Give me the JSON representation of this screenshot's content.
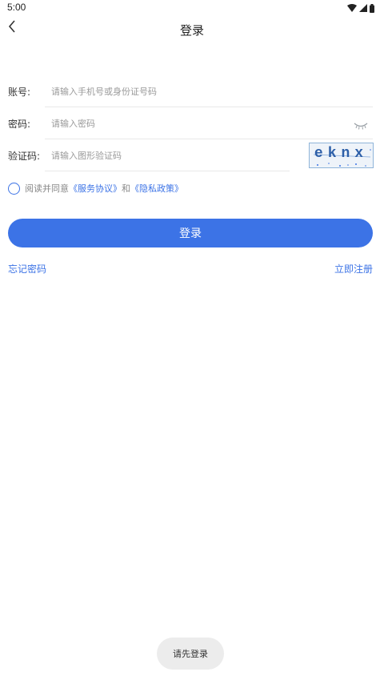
{
  "status_bar": {
    "time": "5:00",
    "icons": [
      "wifi-icon",
      "signal-icon",
      "battery-icon"
    ]
  },
  "nav": {
    "back_icon": "chevron-left-icon",
    "title": "登录"
  },
  "form": {
    "account": {
      "label": "账号:",
      "placeholder": "请输入手机号或身份证号码",
      "value": ""
    },
    "password": {
      "label": "密码:",
      "placeholder": "请输入密码",
      "value": "",
      "toggle_icon": "eye-closed-icon"
    },
    "captcha": {
      "label": "验证码:",
      "placeholder": "请输入图形验证码",
      "value": "",
      "image_text": "eknx"
    }
  },
  "agreement": {
    "checked": false,
    "prefix": "阅读并同意",
    "service_link": "《服务协议》",
    "conjunction": "和",
    "privacy_link": "《隐私政策》"
  },
  "login_button": "登录",
  "links": {
    "forgot_password": "忘记密码",
    "register": "立即注册"
  },
  "toast": "请先登录",
  "colors": {
    "accent": "#3c73e6",
    "toast_bg": "#ececec"
  }
}
